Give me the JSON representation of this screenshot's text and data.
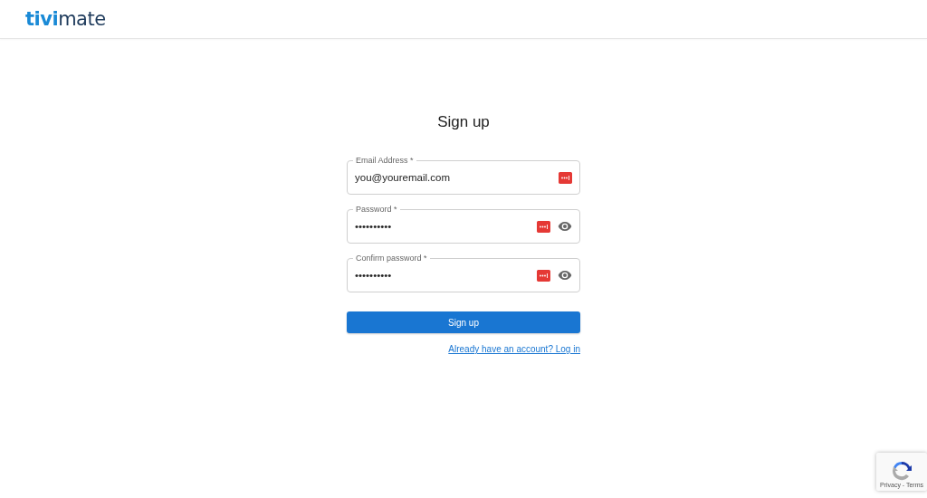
{
  "header": {
    "logo": "**tivi**mate"
  },
  "form": {
    "title": "Sign up",
    "fields": [
      {
        "kind": "plain",
        "label": "Email Address *",
        "value": "you@youremail.com"
      },
      {
        "kind": "secret",
        "label": "Password *",
        "value": "••••••••••"
      },
      {
        "kind": "secret",
        "label": "Confirm password *",
        "value": "••••••••••"
      }
    ],
    "submit": "Sign up",
    "login_link": "Already have an account? Log in"
  },
  "recaptcha": {
    "text": "Privacy - Terms"
  }
}
